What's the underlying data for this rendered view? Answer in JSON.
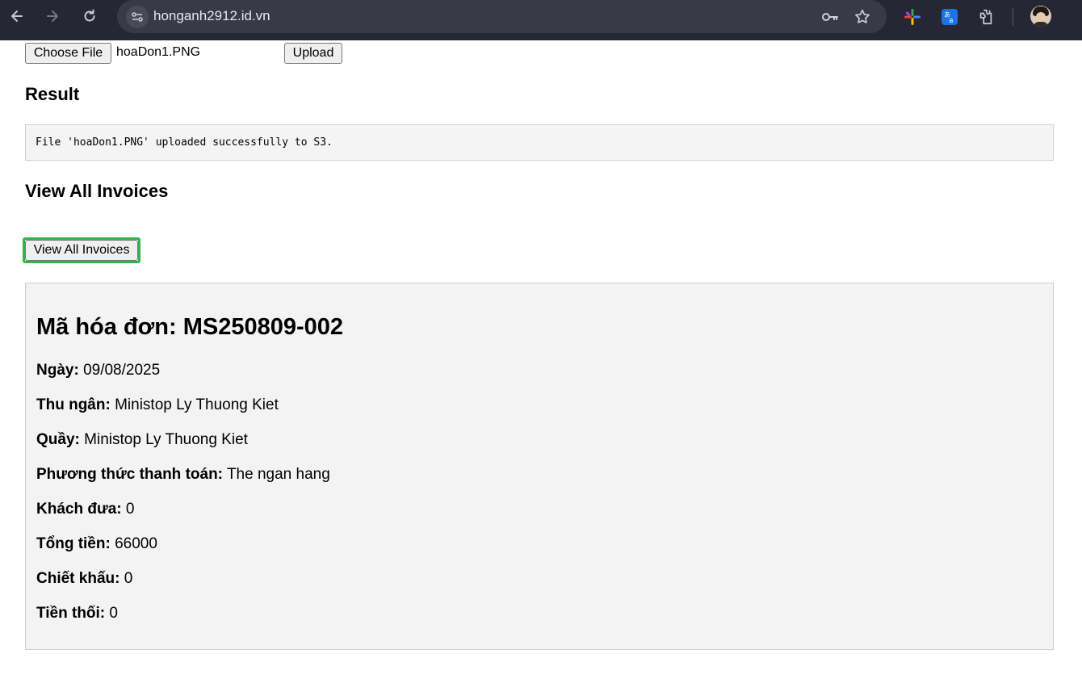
{
  "browser": {
    "url": "honganh2912.id.vn",
    "icons": [
      "back-arrow-icon",
      "forward-arrow-icon",
      "reload-icon",
      "site-info-icon",
      "key-icon",
      "star-icon",
      "puzzle-extension-icon",
      "translate-icon",
      "extensions-icon",
      "profile-avatar"
    ]
  },
  "upload": {
    "choose_label": "Choose File",
    "file_name": "hoaDon1.PNG",
    "upload_label": "Upload"
  },
  "result": {
    "heading": "Result",
    "message": "File 'hoaDon1.PNG' uploaded successfully to S3."
  },
  "invoices": {
    "heading": "View All Invoices",
    "button_label": "View All Invoices"
  },
  "invoice": {
    "title": "Mã hóa đơn: MS250809-002",
    "fields": [
      {
        "label": "Ngày:",
        "value": "09/08/2025"
      },
      {
        "label": "Thu ngân:",
        "value": "Ministop Ly Thuong Kiet"
      },
      {
        "label": "Quầy:",
        "value": "Ministop Ly Thuong Kiet"
      },
      {
        "label": "Phương thức thanh toán:",
        "value": "The ngan hang"
      },
      {
        "label": "Khách đưa:",
        "value": "0"
      },
      {
        "label": "Tổng tiền:",
        "value": "66000"
      },
      {
        "label": "Chiết khấu:",
        "value": "0"
      },
      {
        "label": "Tiền thối:",
        "value": "0"
      }
    ]
  },
  "colors": {
    "chrome": "#272635",
    "focus": "#2fb54a"
  }
}
